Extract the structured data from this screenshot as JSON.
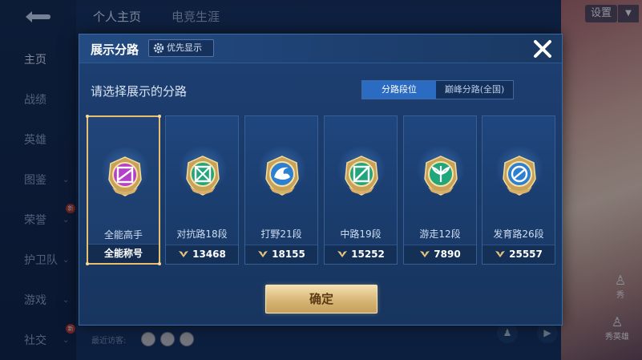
{
  "background": {
    "top_tabs": [
      "个人主页",
      "电竞生涯"
    ],
    "settings_label": "设置",
    "sidebar": [
      {
        "label": "主页",
        "active": true,
        "chevron": false,
        "new": false
      },
      {
        "label": "战绩",
        "active": false,
        "chevron": false,
        "new": false
      },
      {
        "label": "英雄",
        "active": false,
        "chevron": false,
        "new": false
      },
      {
        "label": "图鉴",
        "active": false,
        "chevron": true,
        "new": false
      },
      {
        "label": "荣誉",
        "active": false,
        "chevron": true,
        "new": true
      },
      {
        "label": "护卫队",
        "active": false,
        "chevron": true,
        "new": false
      },
      {
        "label": "游戏",
        "active": false,
        "chevron": true,
        "new": false
      },
      {
        "label": "社交",
        "active": false,
        "chevron": true,
        "new": true
      }
    ],
    "new_badge": "新",
    "recent_visitors_label": "最近访客:",
    "right_buttons": [
      "秀",
      "秀英雄"
    ]
  },
  "dialog": {
    "title": "展示分路",
    "priority_button": "优先显示",
    "subtitle": "请选择展示的分路",
    "toggle": {
      "options": [
        "分路段位",
        "巅峰分路(全国)"
      ],
      "selected_index": 0
    },
    "confirm_label": "确定",
    "cards": [
      {
        "lane": "全能高手",
        "score": "全能称号",
        "emblem": "all-round-emblem-icon",
        "color": "#b43fc8",
        "selected": true
      },
      {
        "lane": "对抗路18段",
        "score": "13468",
        "emblem": "clash-lane-emblem-icon",
        "color": "#1fa67a",
        "selected": false
      },
      {
        "lane": "打野21段",
        "score": "18155",
        "emblem": "jungle-emblem-icon",
        "color": "#2d7fd1",
        "selected": false
      },
      {
        "lane": "中路19段",
        "score": "15252",
        "emblem": "mid-lane-emblem-icon",
        "color": "#1fa67a",
        "selected": false
      },
      {
        "lane": "游走12段",
        "score": "7890",
        "emblem": "roam-emblem-icon",
        "color": "#1fa67a",
        "selected": false
      },
      {
        "lane": "发育路26段",
        "score": "25557",
        "emblem": "farm-lane-emblem-icon",
        "color": "#2d7fd1",
        "selected": false
      }
    ]
  }
}
